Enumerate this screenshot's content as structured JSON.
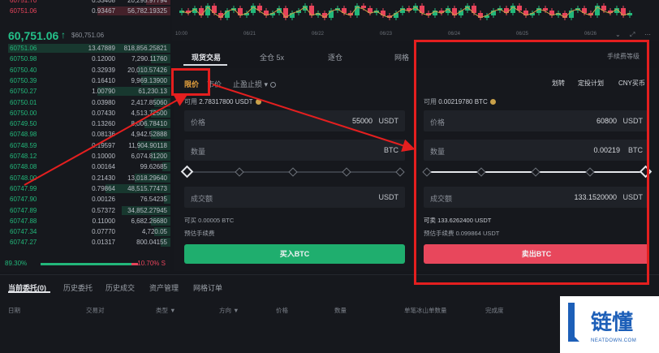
{
  "orderbook": {
    "asks": [
      {
        "price": "60751.70",
        "amount": "0.33408",
        "total": "20,295.97794",
        "depth": 0.15
      },
      {
        "price": "60751.06",
        "amount": "0.93467",
        "total": "56,782.19325",
        "depth": 0.45
      }
    ],
    "last_price": "60,751.06",
    "last_arrow": "↑",
    "last_usd": "$60,751.06",
    "bids": [
      {
        "price": "60751.06",
        "amount": "13.47889",
        "total": "818,856.25821",
        "depth": 1.0
      },
      {
        "price": "60750.98",
        "amount": "0.12000",
        "total": "7,290.11760",
        "depth": 0.12
      },
      {
        "price": "60750.40",
        "amount": "0.32939",
        "total": "20,010.57426",
        "depth": 0.2
      },
      {
        "price": "60750.39",
        "amount": "0.16410",
        "total": "9,969.13900",
        "depth": 0.18
      },
      {
        "price": "60750.27",
        "amount": "1.00790",
        "total": "61,230.13",
        "depth": 0.45
      },
      {
        "price": "60750.01",
        "amount": "0.03980",
        "total": "2,417.85060",
        "depth": 0.1
      },
      {
        "price": "60750.00",
        "amount": "0.07430",
        "total": "4,513.72500",
        "depth": 0.12
      },
      {
        "price": "60749.50",
        "amount": "0.13260",
        "total": "8,006.78410",
        "depth": 0.16
      },
      {
        "price": "60748.98",
        "amount": "0.08136",
        "total": "4,942.52888",
        "depth": 0.12
      },
      {
        "price": "60748.59",
        "amount": "0.19597",
        "total": "11,904.90118",
        "depth": 0.2
      },
      {
        "price": "60748.12",
        "amount": "0.10000",
        "total": "6,074.81200",
        "depth": 0.12
      },
      {
        "price": "60748.08",
        "amount": "0.00164",
        "total": "99.62685",
        "depth": 0.05
      },
      {
        "price": "60748.00",
        "amount": "0.21430",
        "total": "13,018.29640",
        "depth": 0.22
      },
      {
        "price": "60747.99",
        "amount": "0.79864",
        "total": "48,515.77473",
        "depth": 0.4
      },
      {
        "price": "60747.90",
        "amount": "0.00126",
        "total": "76.54235",
        "depth": 0.04
      },
      {
        "price": "60747.89",
        "amount": "0.57372",
        "total": "34,852.27945",
        "depth": 0.3
      },
      {
        "price": "60747.88",
        "amount": "0.11000",
        "total": "6,682.26680",
        "depth": 0.12
      },
      {
        "price": "60747.34",
        "amount": "0.07770",
        "total": "4,720.05",
        "depth": 0.1
      },
      {
        "price": "60747.27",
        "amount": "0.01317",
        "total": "800.04155",
        "depth": 0.06
      }
    ],
    "buy_pct": "89.30%",
    "sell_pct": "10.70%",
    "sell_suffix": "S"
  },
  "chart": {
    "x_ticks": [
      "10:00",
      "06/21",
      "06/22",
      "06/23",
      "06/24",
      "06/25",
      "06/26"
    ],
    "controls": [
      "⌄",
      "⤢",
      "⋯"
    ],
    "candles": [
      0.7,
      0.6,
      0.8,
      0.5,
      0.9,
      0.6,
      0.4,
      0.7,
      0.8,
      0.5,
      0.6,
      0.9,
      0.7,
      0.5,
      0.6,
      0.8,
      0.4,
      0.6,
      0.7,
      0.9,
      0.5,
      0.6,
      0.4,
      0.7,
      0.8,
      0.6,
      0.5,
      0.9,
      0.8,
      0.6,
      0.7,
      0.5,
      0.4,
      0.6,
      0.8,
      0.7,
      0.9,
      0.6,
      0.5,
      0.7,
      0.6,
      0.8,
      0.5,
      0.7,
      0.9,
      0.6,
      0.4,
      0.5,
      0.7,
      0.8,
      0.6,
      0.9,
      0.7,
      0.5,
      0.6,
      0.8,
      0.7,
      0.5,
      0.6,
      0.4,
      0.7,
      0.8,
      0.6,
      0.5,
      0.9,
      0.7,
      0.6,
      0.8,
      0.5,
      0.6
    ],
    "colors": {
      "up": "#22b77a",
      "down": "#e8445b"
    }
  },
  "trade_tabs": [
    {
      "label": "现货交易",
      "active": true
    },
    {
      "label": "全仓 5x",
      "active": false
    },
    {
      "label": "逐仓",
      "active": false
    },
    {
      "label": "网格",
      "active": false
    }
  ],
  "fee_level": "手续费等级",
  "buy": {
    "order_types": {
      "limit": "限价",
      "market": "市价",
      "stop": "止盈止损"
    },
    "available_label": "可用",
    "available": "2.78317800 USDT",
    "price_label": "价格",
    "price_value": "55000",
    "price_unit": "USDT",
    "qty_label": "数量",
    "qty_unit": "BTC",
    "total_label": "成交额",
    "total_unit": "USDT",
    "can_buy": "可买 0.00005 BTC",
    "fee_est": "预估手续费",
    "button": "买入BTC",
    "slider_level": 0
  },
  "sell": {
    "links": [
      "划转",
      "定投计划",
      "CNY买币"
    ],
    "available_label": "可用",
    "available": "0.00219780 BTC",
    "price_label": "价格",
    "price_value": "60800",
    "price_unit": "USDT",
    "qty_label": "数量",
    "qty_value": "0.00219",
    "qty_unit": "BTC",
    "total_label": "成交额",
    "total_value": "133.1520000",
    "total_unit": "USDT",
    "can_sell": "可卖  133.6262400 USDT",
    "fee_est": "预估手续费  0.099864 USDT",
    "button": "卖出BTC",
    "slider_level": 1.0
  },
  "orders": {
    "tabs": [
      "当前委托(0)",
      "历史委托",
      "历史成交",
      "资产管理",
      "网格订单"
    ],
    "columns": [
      "日期",
      "交易对",
      "类型 ▼",
      "方向 ▼",
      "价格",
      "数量",
      "单笔冰山单数量",
      "完成度"
    ]
  },
  "logo": {
    "text": "链懂",
    "url": "NEATDOWN.COM"
  },
  "accent": {
    "highlight": "#e41f1f",
    "buy": "#1fae6e",
    "sell": "#e8475c",
    "limit": "#e8a33d"
  }
}
